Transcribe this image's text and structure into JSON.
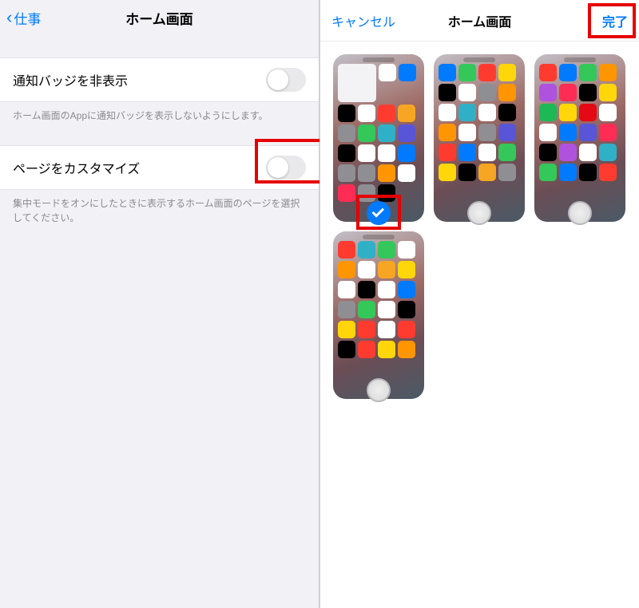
{
  "left": {
    "back_label": "仕事",
    "title": "ホーム画面",
    "row1": {
      "label": "通知バッジを非表示",
      "desc": "ホーム画面のAppに通知バッジを表示しないようにします。"
    },
    "row2": {
      "label": "ページをカスタマイズ",
      "desc": "集中モードをオンにしたときに表示するホーム画面のページを選択してください。"
    }
  },
  "right": {
    "cancel_label": "キャンセル",
    "title": "ホーム画面",
    "done_label": "完了",
    "pages": [
      {
        "selected": true
      },
      {
        "selected": false
      },
      {
        "selected": false
      },
      {
        "selected": false
      }
    ]
  },
  "colors": {
    "accent": "#007aff",
    "annotation": "#e60000"
  }
}
